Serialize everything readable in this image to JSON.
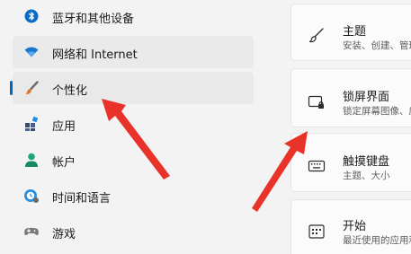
{
  "sidebar": {
    "items": [
      {
        "label": "蓝牙和其他设备",
        "icon": "bluetooth-icon"
      },
      {
        "label": "网络和 Internet",
        "icon": "wifi-icon"
      },
      {
        "label": "个性化",
        "icon": "paintbrush-icon"
      },
      {
        "label": "应用",
        "icon": "apps-icon"
      },
      {
        "label": "帐户",
        "icon": "account-icon"
      },
      {
        "label": "时间和语言",
        "icon": "clock-globe-icon"
      },
      {
        "label": "游戏",
        "icon": "gamepad-icon"
      }
    ],
    "selected_index": 2
  },
  "cards": [
    {
      "title": "主题",
      "subtitle": "安装、创建、管理",
      "icon": "brush-icon"
    },
    {
      "title": "锁屏界面",
      "subtitle": "锁定屏幕图像、应用",
      "icon": "lock-screen-icon"
    },
    {
      "title": "触摸键盘",
      "subtitle": "主题、大小",
      "icon": "keyboard-icon"
    },
    {
      "title": "开始",
      "subtitle": "最近使用的应用和项",
      "icon": "start-icon"
    }
  ],
  "colors": {
    "accent": "#0067c0",
    "annotation_arrow": "#e8322a"
  }
}
